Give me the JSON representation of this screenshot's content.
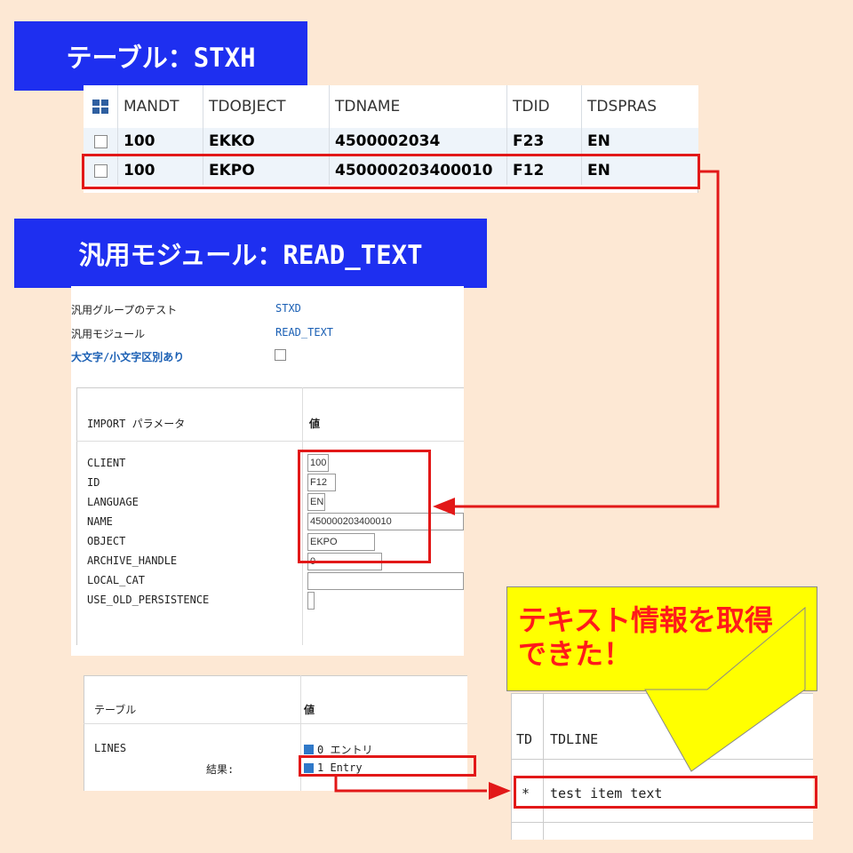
{
  "banners": {
    "table": "テーブル：STXH",
    "function_module": "汎用モジュール：READ_TEXT"
  },
  "stxh": {
    "columns": [
      "MANDT",
      "TDOBJECT",
      "TDNAME",
      "TDID",
      "TDSPRAS"
    ],
    "rows": [
      [
        "100",
        "EKKO",
        "4500002034",
        "F23",
        "EN"
      ],
      [
        "100",
        "EKPO",
        "450000203400010",
        "F12",
        "EN"
      ]
    ]
  },
  "fm": {
    "group_label": "汎用グループのテスト",
    "group_value": "STXD",
    "module_label": "汎用モジュール",
    "module_value": "READ_TEXT",
    "case_label": "大文字/小文字区別あり",
    "import_header": "IMPORT パラメータ",
    "value_header": "値",
    "params": [
      {
        "name": "CLIENT",
        "value": "100"
      },
      {
        "name": "ID",
        "value": "F12"
      },
      {
        "name": "LANGUAGE",
        "value": "EN"
      },
      {
        "name": "NAME",
        "value": "450000203400010"
      },
      {
        "name": "OBJECT",
        "value": "EKPO"
      },
      {
        "name": "ARCHIVE_HANDLE",
        "value": "0"
      },
      {
        "name": "LOCAL_CAT",
        "value": ""
      },
      {
        "name": "USE_OLD_PERSISTENCE",
        "value": ""
      }
    ]
  },
  "tables_panel": {
    "table_header": "テーブル",
    "value_header": "値",
    "lines_label": "LINES",
    "lines_value": "0 エントリ",
    "result_label": "結果:",
    "result_value": "1 Entry"
  },
  "tdline": {
    "col1": "TD",
    "col2": "TDLINE",
    "row_format": "*",
    "row_text": "test item text"
  },
  "note": {
    "line1": "テキスト情報を取得",
    "line2": "できた！"
  },
  "colors": {
    "banner": "#1e2ff0",
    "highlight": "#e21818",
    "note_bg": "#ffff00",
    "note_text": "#ff1a1a",
    "page_bg": "#fde8d4"
  }
}
